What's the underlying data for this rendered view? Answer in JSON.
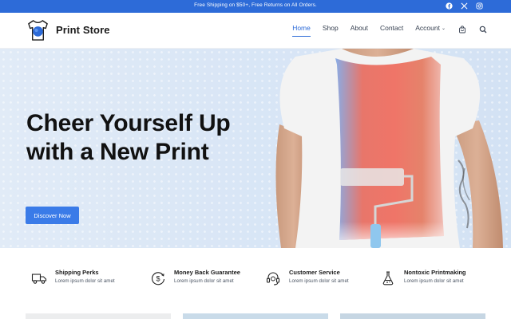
{
  "topbar": {
    "announcement": "Free Shipping on $50+, Free Returns on All Orders.",
    "social": [
      "facebook-icon",
      "x-icon",
      "instagram-icon"
    ]
  },
  "header": {
    "brand": "Print Store",
    "nav": [
      {
        "label": "Home",
        "active": true
      },
      {
        "label": "Shop",
        "active": false
      },
      {
        "label": "About",
        "active": false
      },
      {
        "label": "Contact",
        "active": false
      },
      {
        "label": "Account",
        "active": false,
        "dropdown": true
      }
    ],
    "icons": [
      "cart-icon",
      "search-icon"
    ]
  },
  "hero": {
    "title": "Cheer Yourself Up with a New Print",
    "button": "Discover Now"
  },
  "features": [
    {
      "icon": "truck-icon",
      "title": "Shipping Perks",
      "desc": "Lorem ipsum dolor sit amet"
    },
    {
      "icon": "money-back-icon",
      "title": "Money Back Guarantee",
      "desc": "Lorem ipsum dolor sit amet"
    },
    {
      "icon": "headset-icon",
      "title": "Customer Service",
      "desc": "Lorem ipsum dolor sit amet"
    },
    {
      "icon": "flask-icon",
      "title": "Nontoxic Printmaking",
      "desc": "Lorem ipsum dolor sit amet"
    }
  ],
  "colors": {
    "accent": "#2d6bd8",
    "button": "#3a7be8",
    "hero_bg": "#dae6f6"
  }
}
